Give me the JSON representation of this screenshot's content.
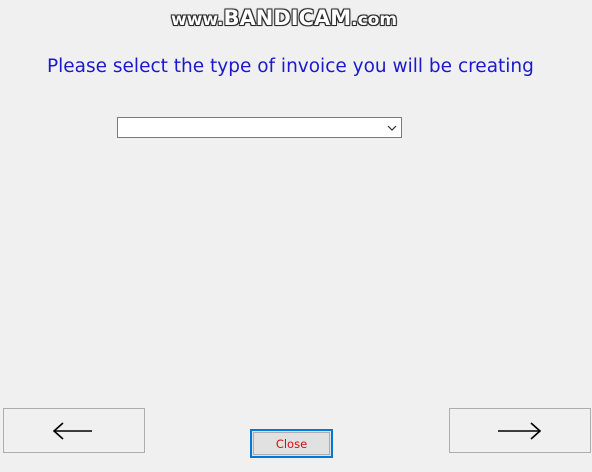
{
  "watermark": {
    "prefix": "www.",
    "brand": "BANDICAM",
    "suffix": ".com"
  },
  "prompt_text": "Please select the type of invoice you will be creating",
  "invoice_type_select": {
    "selected_value": ""
  },
  "buttons": {
    "close_label": "Close"
  },
  "colors": {
    "prompt_text": "#1a1acc",
    "close_text": "#cc1111",
    "focus_border": "#0078d7",
    "background": "#f0f0f0"
  },
  "icons": {
    "back": "left-arrow-icon",
    "next": "right-arrow-icon",
    "dropdown": "chevron-down-icon"
  }
}
